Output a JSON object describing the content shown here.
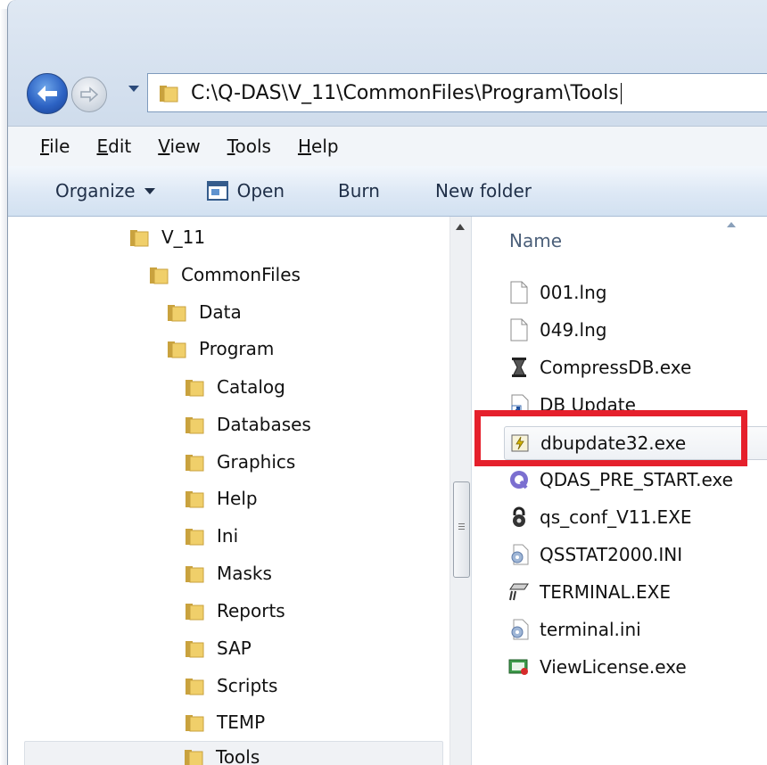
{
  "address_bar": {
    "path": "C:\\Q-DAS\\V_11\\CommonFiles\\Program\\Tools"
  },
  "menu": [
    {
      "label": "File",
      "accel": "F",
      "rest": "ile"
    },
    {
      "label": "Edit",
      "accel": "E",
      "rest": "dit"
    },
    {
      "label": "View",
      "accel": "V",
      "rest": "iew"
    },
    {
      "label": "Tools",
      "accel": "T",
      "rest": "ools"
    },
    {
      "label": "Help",
      "accel": "H",
      "rest": "elp"
    }
  ],
  "toolbar": {
    "organize_label": "Organize",
    "open_label": "Open",
    "burn_label": "Burn",
    "new_folder_label": "New folder"
  },
  "tree": [
    {
      "label": "V_11",
      "level": 0
    },
    {
      "label": "CommonFiles",
      "level": 1
    },
    {
      "label": "Data",
      "level": 2
    },
    {
      "label": "Program",
      "level": 2
    },
    {
      "label": "Catalog",
      "level": 3
    },
    {
      "label": "Databases",
      "level": 3
    },
    {
      "label": "Graphics",
      "level": 3
    },
    {
      "label": "Help",
      "level": 3
    },
    {
      "label": "Ini",
      "level": 3
    },
    {
      "label": "Masks",
      "level": 3
    },
    {
      "label": "Reports",
      "level": 3
    },
    {
      "label": "SAP",
      "level": 3
    },
    {
      "label": "Scripts",
      "level": 3
    },
    {
      "label": "TEMP",
      "level": 3
    },
    {
      "label": "Tools",
      "level": 3,
      "selected": true
    }
  ],
  "file_list": {
    "column_name": "Name",
    "files": [
      {
        "name": "001.lng",
        "icon": "blank-file-icon"
      },
      {
        "name": "049.lng",
        "icon": "blank-file-icon"
      },
      {
        "name": "CompressDB.exe",
        "icon": "compress-db-icon"
      },
      {
        "name": "DB Update",
        "icon": "shortcut-icon"
      },
      {
        "name": "dbupdate32.exe",
        "icon": "dbupdate-exe-icon",
        "highlighted": true
      },
      {
        "name": "QDAS_PRE_START.exe",
        "icon": "qdas-q-icon"
      },
      {
        "name": "qs_conf_V11.EXE",
        "icon": "lock-icon"
      },
      {
        "name": "QSSTAT2000.INI",
        "icon": "settings-file-icon"
      },
      {
        "name": "TERMINAL.EXE",
        "icon": "terminal-icon"
      },
      {
        "name": "terminal.ini",
        "icon": "settings-file-icon"
      },
      {
        "name": "ViewLicense.exe",
        "icon": "license-icon"
      }
    ]
  },
  "colors": {
    "highlight_border": "#e5202c",
    "folder": "#e9c45a"
  }
}
